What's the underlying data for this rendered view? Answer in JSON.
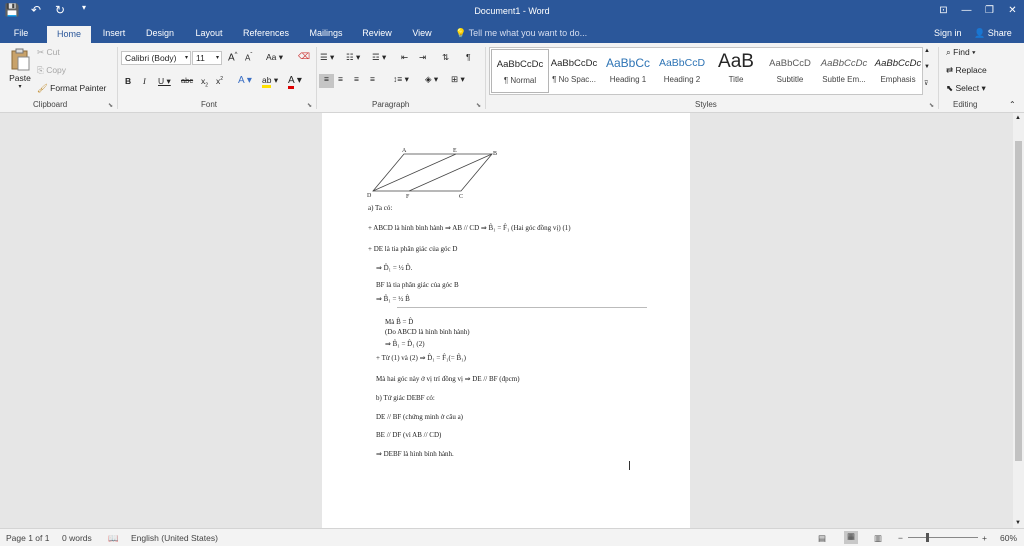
{
  "titlebar": {
    "title": "Document1 - Word"
  },
  "tabs": [
    {
      "label": "File"
    },
    {
      "label": "Home"
    },
    {
      "label": "Insert"
    },
    {
      "label": "Design"
    },
    {
      "label": "Layout"
    },
    {
      "label": "References"
    },
    {
      "label": "Mailings"
    },
    {
      "label": "Review"
    },
    {
      "label": "View"
    }
  ],
  "tellme": "Tell me what you want to do...",
  "signin": "Sign in",
  "share": "Share",
  "clipboard": {
    "paste": "Paste",
    "cut": "Cut",
    "copy": "Copy",
    "format_painter": "Format Painter",
    "group": "Clipboard"
  },
  "font": {
    "name": "Calibri (Body)",
    "size": "11",
    "group": "Font",
    "change_case": "Aa",
    "strike": "abc"
  },
  "paragraph": {
    "group": "Paragraph"
  },
  "styles": {
    "group": "Styles",
    "items": [
      {
        "sample": "AaBbCcDc",
        "name": "¶ Normal"
      },
      {
        "sample": "AaBbCcDc",
        "name": "¶ No Spac..."
      },
      {
        "sample": "AaBbCc",
        "name": "Heading 1"
      },
      {
        "sample": "AaBbCcD",
        "name": "Heading 2"
      },
      {
        "sample": "AaB",
        "name": "Title"
      },
      {
        "sample": "AaBbCcD",
        "name": "Subtitle"
      },
      {
        "sample": "AaBbCcDc",
        "name": "Subtle Em..."
      },
      {
        "sample": "AaBbCcDc",
        "name": "Emphasis"
      }
    ]
  },
  "editing": {
    "find": "Find",
    "replace": "Replace",
    "select": "Select",
    "group": "Editing"
  },
  "document": {
    "figure_labels": {
      "A": "A",
      "E": "E",
      "B": "B",
      "D": "D",
      "F": "F",
      "C": "C"
    },
    "lines": [
      "a) Ta có:",
      "+ ABCD là hình bình hành ⇒ AB // CD ⇒ B̂₁ = F̂₁ (Hai góc đồng vị) (1)",
      "+ DE là tia phân giác của góc D",
      "⇒ D̂₁ = ½ D̂.",
      "BF là tia phân giác của góc B",
      "⇒ B̂₁ = ½ B̂",
      "Mà B̂ = D̂",
      "(Do ABCD là hình bình hành)",
      "⇒ B̂₁ = D̂₁                    (2)",
      "+ Từ (1) và (2) ⇒  D̂₁ = F̂₁(= B̂₁)",
      "Mà hai góc này ở vị trí đồng vị ⇒ DE // BF (đpcm)",
      "b) Tứ giác DEBF có:",
      "DE // BF (chứng minh ở câu a)",
      "BE // DF (vì AB // CD)",
      "⇒ DEBF là hình bình hành."
    ]
  },
  "status": {
    "page": "Page 1 of 1",
    "words": "0 words",
    "language": "English (United States)",
    "zoom": "60%"
  }
}
